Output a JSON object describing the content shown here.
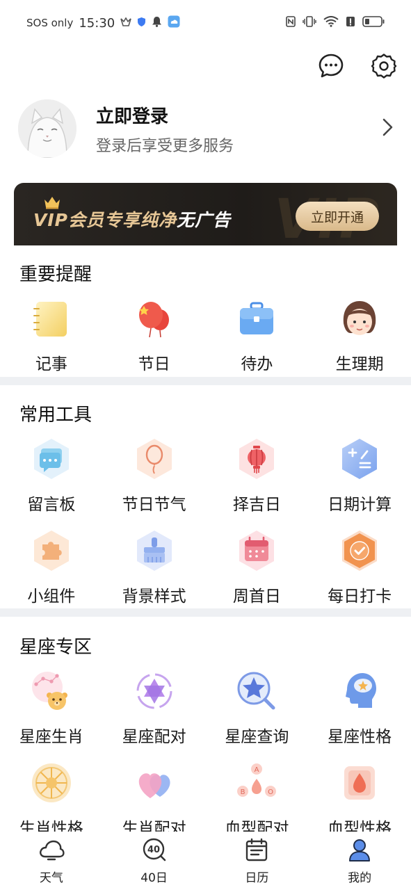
{
  "status_bar": {
    "network": "SOS only",
    "time": "15:30",
    "icons": [
      "app-icon",
      "shield-icon",
      "bell-icon",
      "weather-icon",
      "nfc-icon",
      "vibrate-icon",
      "wifi-icon",
      "alert-icon",
      "battery-icon"
    ]
  },
  "top_actions": [
    {
      "icon": "message-icon"
    },
    {
      "icon": "settings-icon"
    }
  ],
  "profile": {
    "title": "立即登录",
    "subtitle": "登录后享受更多服务"
  },
  "vip": {
    "text_main": "VIP会员专享纯净",
    "text_highlight": "无广告",
    "button": "立即开通",
    "deco": "VIP"
  },
  "sections": [
    {
      "title": "重要提醒",
      "rows": [
        [
          {
            "label": "记事",
            "icon": "notepad-icon"
          },
          {
            "label": "节日",
            "icon": "balloon-icon"
          },
          {
            "label": "待办",
            "icon": "briefcase-icon"
          },
          {
            "label": "生理期",
            "icon": "girl-face-icon"
          }
        ]
      ]
    },
    {
      "title": "常用工具",
      "rows": [
        [
          {
            "label": "留言板",
            "icon": "chat-bubble-icon"
          },
          {
            "label": "节日节气",
            "icon": "balloon-outline-icon"
          },
          {
            "label": "择吉日",
            "icon": "lantern-icon"
          },
          {
            "label": "日期计算",
            "icon": "calculator-icon"
          }
        ],
        [
          {
            "label": "小组件",
            "icon": "puzzle-icon"
          },
          {
            "label": "背景样式",
            "icon": "brush-icon"
          },
          {
            "label": "周首日",
            "icon": "calendar-icon"
          },
          {
            "label": "每日打卡",
            "icon": "checkmark-icon"
          }
        ]
      ]
    },
    {
      "title": "星座专区",
      "rows": [
        [
          {
            "label": "星座生肖",
            "icon": "zodiac-bear-icon"
          },
          {
            "label": "星座配对",
            "icon": "hexagram-icon"
          },
          {
            "label": "星座查询",
            "icon": "star-search-icon"
          },
          {
            "label": "星座性格",
            "icon": "head-star-icon"
          }
        ],
        [
          {
            "label": "生肖性格",
            "icon": "sun-wheel-icon"
          },
          {
            "label": "生肖配对",
            "icon": "hearts-icon"
          },
          {
            "label": "血型配对",
            "icon": "blood-type-icon"
          },
          {
            "label": "血型性格",
            "icon": "blood-drop-icon"
          }
        ]
      ]
    }
  ],
  "bottom_nav": [
    {
      "label": "天气",
      "icon": "cloud-icon",
      "active": false
    },
    {
      "label": "40日",
      "icon": "forty-day-icon",
      "active": false
    },
    {
      "label": "日历",
      "icon": "calendar-nav-icon",
      "active": false
    },
    {
      "label": "我的",
      "icon": "user-icon",
      "active": true
    }
  ]
}
